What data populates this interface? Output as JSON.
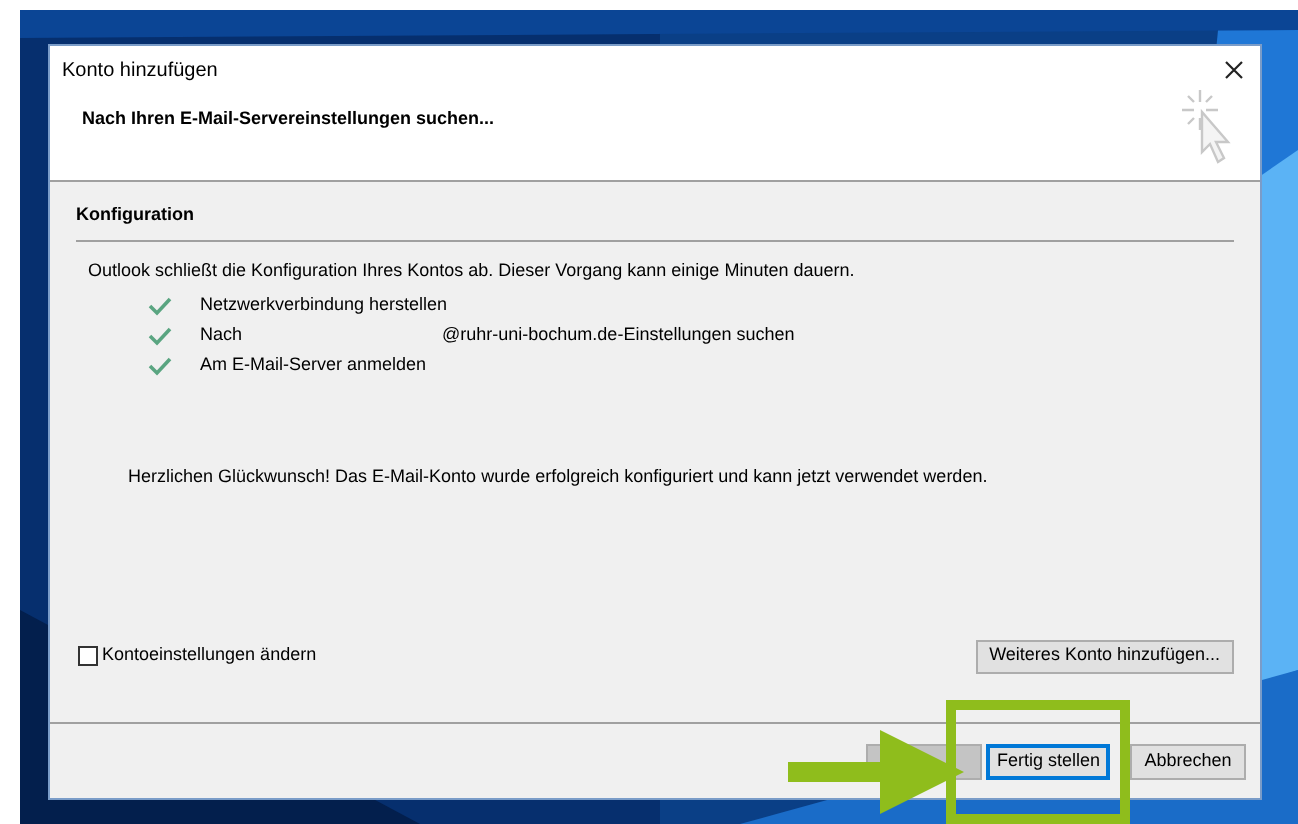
{
  "window": {
    "title": "Konto hinzufügen"
  },
  "header": {
    "title": "Nach Ihren E-Mail-Servereinstellungen suchen..."
  },
  "section": {
    "title": "Konfiguration"
  },
  "intro": "Outlook schließt die Konfiguration Ihres Kontos ab. Dieser Vorgang kann einige Minuten dauern.",
  "steps": [
    {
      "label": "Netzwerkverbindung herstellen",
      "done": true
    },
    {
      "label": "Nach",
      "suffix": "@ruhr-uni-bochum.de-Einstellungen suchen",
      "done": true
    },
    {
      "label": "Am E-Mail-Server anmelden",
      "done": true
    }
  ],
  "message": "Herzlichen Glückwunsch! Das E-Mail-Konto wurde erfolgreich konfiguriert und kann jetzt verwendet werden.",
  "change_settings": {
    "label": "Kontoeinstellungen ändern",
    "checked": false
  },
  "add_account_button": "Weiteres Konto hinzufügen...",
  "buttons": [
    {
      "disabled": true,
      "focused": false
    },
    {
      "label": "Fertig stellen",
      "disabled": false,
      "focused": true
    },
    {
      "label": "Abbrechen",
      "disabled": false,
      "focused": false
    }
  ]
}
